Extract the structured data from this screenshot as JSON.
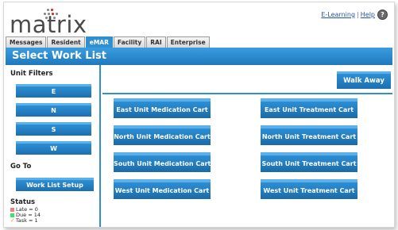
{
  "app": {
    "logo_text": "matrix",
    "links": {
      "elearning": "E-Learning",
      "separator": "|",
      "help": "Help"
    }
  },
  "tabs": [
    {
      "label": "Messages",
      "active": false
    },
    {
      "label": "Resident",
      "active": false
    },
    {
      "label": "eMAR",
      "active": true
    },
    {
      "label": "Facility",
      "active": false
    },
    {
      "label": "RAI",
      "active": false
    },
    {
      "label": "Enterprise",
      "active": false
    }
  ],
  "page_title": "Select Work List",
  "sidebar": {
    "unit_filters_label": "Unit Filters",
    "unit_filters": [
      "E",
      "N",
      "S",
      "W"
    ],
    "goto_label": "Go To",
    "worklist_setup_label": "Work List Setup",
    "status_label": "Status",
    "status_items": [
      {
        "text": "Late = 0",
        "color": "#f08080",
        "icon": "square"
      },
      {
        "text": "Due = 14",
        "color": "#3fe070",
        "icon": "square"
      },
      {
        "text": "Task = 1",
        "color": "#d6a500",
        "icon": "check-icon"
      }
    ]
  },
  "main": {
    "walk_away_label": "Walk Away",
    "carts": [
      {
        "label": "East Unit Medication Cart"
      },
      {
        "label": "East Unit Treatment Cart"
      },
      {
        "label": "North Unit Medication Cart"
      },
      {
        "label": "North Unit Treatment Cart"
      },
      {
        "label": "South Unit Medication Cart"
      },
      {
        "label": "South Unit Treatment Cart"
      },
      {
        "label": "West Unit Medication Cart"
      },
      {
        "label": "West Unit Treatment Cart"
      }
    ]
  },
  "colors": {
    "accent": "#2f8fd0",
    "button": "#1f78bc",
    "link": "#2255aa"
  }
}
